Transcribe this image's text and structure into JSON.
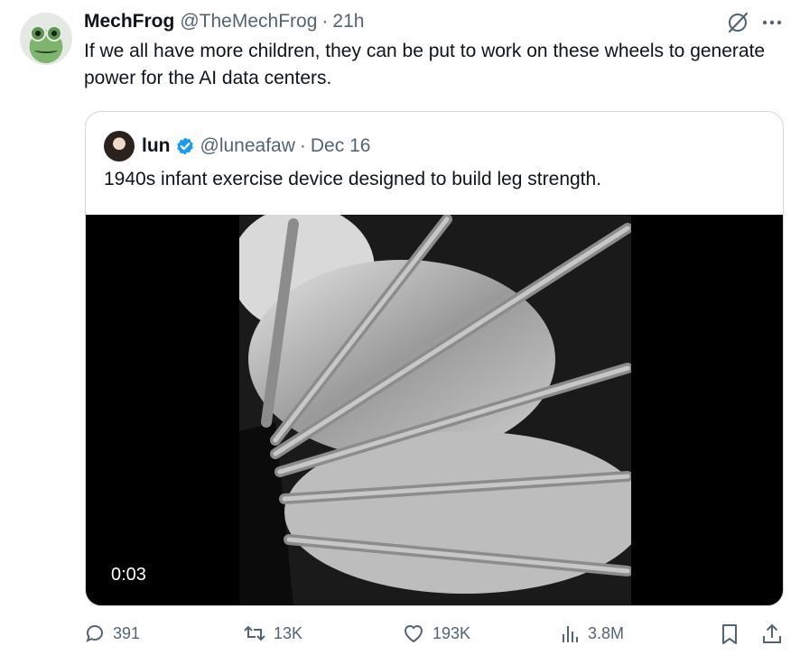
{
  "author": {
    "name": "MechFrog",
    "handle": "@TheMechFrog",
    "separator": "·",
    "time": "21h"
  },
  "tweet": {
    "text": "If we all have more children, they can be put to work on these wheels to generate power for the AI data centers."
  },
  "icons": {
    "grok": "grok-icon",
    "more": "more-icon",
    "verified": "verified-badge-icon",
    "reply": "reply-icon",
    "retweet": "retweet-icon",
    "like": "heart-icon",
    "views": "views-chart-icon",
    "bookmark": "bookmark-icon",
    "share": "share-icon"
  },
  "quote": {
    "name": "lun",
    "handle": "@luneafaw",
    "separator": "·",
    "date": "Dec 16",
    "text": "1940s infant exercise device designed to build leg strength.",
    "video": {
      "timestamp": "0:03"
    }
  },
  "actions": {
    "replies": "391",
    "retweets": "13K",
    "likes": "193K",
    "views": "3.8M"
  },
  "colors": {
    "text": "#0f1419",
    "secondary": "#536471",
    "border": "#cfd9de",
    "verified": "#1d9bf0",
    "video_bg": "#000000"
  }
}
